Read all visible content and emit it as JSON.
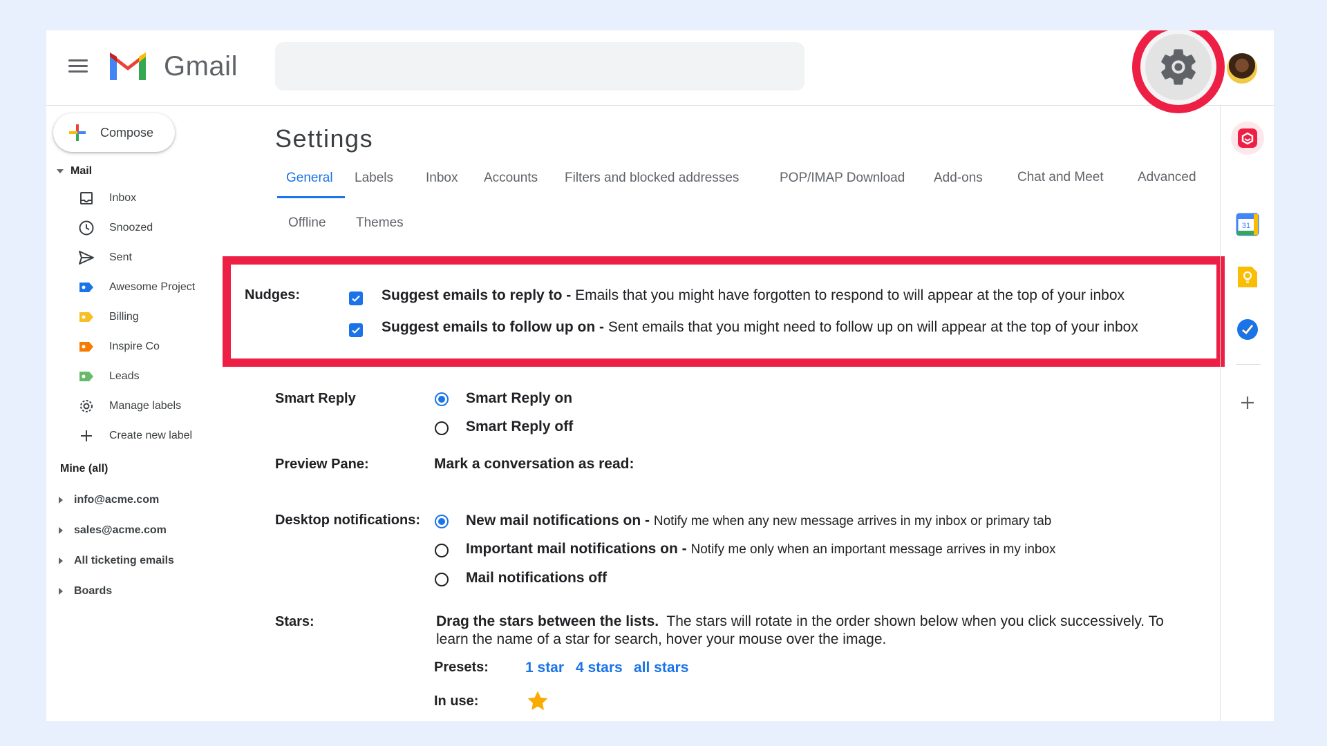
{
  "header": {
    "brand": "Gmail",
    "search_placeholder": ""
  },
  "sidebar": {
    "compose_label": "Compose",
    "mail_label": "Mail",
    "items": [
      {
        "label": "Inbox",
        "icon": "inbox-icon"
      },
      {
        "label": "Snoozed",
        "icon": "clock-icon"
      },
      {
        "label": "Sent",
        "icon": "send-icon"
      },
      {
        "label": "Awesome Project",
        "icon": "label-icon",
        "color": "#1a73e8"
      },
      {
        "label": "Billing",
        "icon": "label-icon",
        "color": "#f6bf26"
      },
      {
        "label": "Inspire Co",
        "icon": "label-icon",
        "color": "#f57c00"
      },
      {
        "label": "Leads",
        "icon": "label-icon",
        "color": "#66bb6a"
      },
      {
        "label": "Manage labels",
        "icon": "gear-icon"
      },
      {
        "label": "Create new label",
        "icon": "plus-icon"
      }
    ],
    "mine_label": "Mine (all)",
    "accounts": [
      "info@acme.com",
      "sales@acme.com",
      "All ticketing emails",
      "Boards"
    ]
  },
  "settings": {
    "title": "Settings",
    "tabs": [
      "General",
      "Labels",
      "Inbox",
      "Accounts",
      "Filters and blocked addresses",
      "POP/IMAP Download",
      "Add-ons",
      "Chat and Meet",
      "Advanced",
      "Offline",
      "Themes"
    ],
    "nudges": {
      "label": "Nudges:",
      "reply_title": "Suggest emails to reply to -",
      "reply_desc": "Emails that you might have forgotten to respond to will appear at the top of your inbox",
      "follow_title": "Suggest emails to follow up on -",
      "follow_desc": "Sent emails that you might need to follow up on will appear at the top of your inbox"
    },
    "smart_reply": {
      "label": "Smart Reply",
      "on": "Smart Reply on",
      "off": "Smart Reply off"
    },
    "preview": {
      "label": "Preview Pane:",
      "value": "Mark a conversation as read:"
    },
    "desktop": {
      "label": "Desktop notifications:",
      "new_title": "New mail notifications on -",
      "new_desc": "Notify me when any new message arrives in my inbox or primary tab",
      "important_title": "Important mail notifications on -",
      "important_desc": "Notify me only when an important message arrives in my inbox",
      "off": "Mail notifications off"
    },
    "stars": {
      "label": "Stars:",
      "bold": "Drag the stars between the lists.",
      "desc1": "The stars will rotate in the order shown below when you click successively. To",
      "desc2": "learn the name of a star for search, hover your mouse over the image.",
      "presets_label": "Presets:",
      "presets": [
        "1 star",
        "4 stars",
        "all stars"
      ],
      "in_use_label": "In use:"
    }
  },
  "colors": {
    "accent": "#1a73e8",
    "highlight": "#ee1f45",
    "star": "#f9ab00"
  }
}
